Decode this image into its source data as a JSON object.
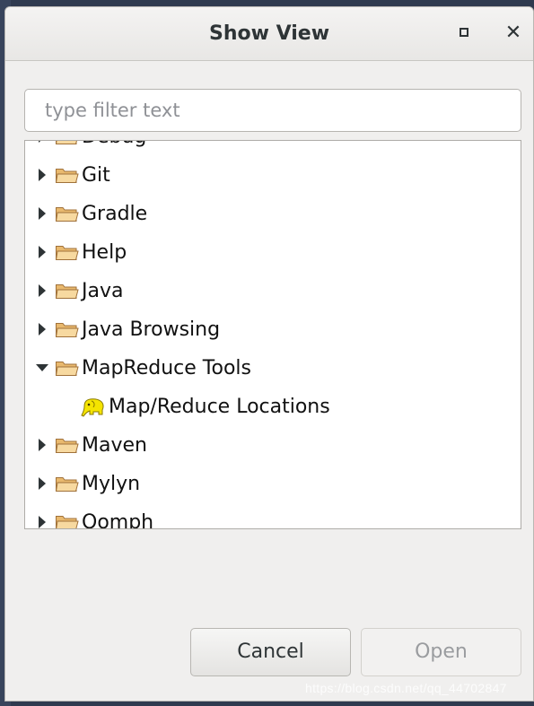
{
  "window": {
    "title": "Show View"
  },
  "filter": {
    "placeholder": "type filter text",
    "value": ""
  },
  "tree": {
    "items": [
      {
        "label": "Debug",
        "expanded": false
      },
      {
        "label": "Git",
        "expanded": false
      },
      {
        "label": "Gradle",
        "expanded": false
      },
      {
        "label": "Help",
        "expanded": false
      },
      {
        "label": "Java",
        "expanded": false
      },
      {
        "label": "Java Browsing",
        "expanded": false
      },
      {
        "label": "MapReduce Tools",
        "expanded": true,
        "children": [
          {
            "label": "Map/Reduce Locations",
            "icon": "elephant-icon"
          }
        ]
      },
      {
        "label": "Maven",
        "expanded": false
      },
      {
        "label": "Mylyn",
        "expanded": false
      },
      {
        "label": "Oomph",
        "expanded": false
      }
    ]
  },
  "buttons": {
    "cancel": "Cancel",
    "open": "Open"
  },
  "watermark": "https://blog.csdn.net/qq_44702847",
  "colors": {
    "folder": "#e9b96e",
    "folder_edge": "#a0713a",
    "elephant": "#f5e400"
  }
}
